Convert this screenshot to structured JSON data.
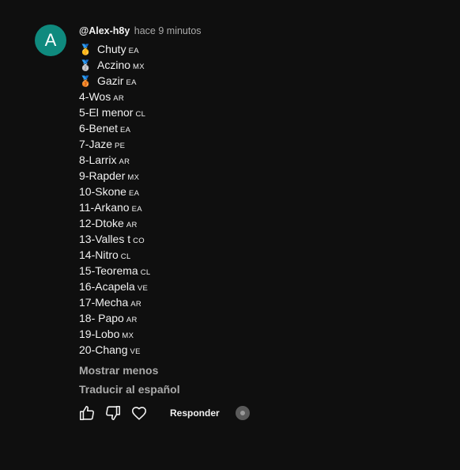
{
  "comment": {
    "avatar_letter": "A",
    "author": "@Alex-h8y",
    "time": "hace 9 minutos",
    "medals": [
      {
        "icon": "gold-medal",
        "glyph": "🥇",
        "name": "Chuty",
        "cc": "EA"
      },
      {
        "icon": "silver-medal",
        "glyph": "🥈",
        "name": "Aczino",
        "cc": "MX"
      },
      {
        "icon": "bronze-medal",
        "glyph": "🥉",
        "name": "Gazir",
        "cc": "EA"
      }
    ],
    "ranking": [
      {
        "name": "4-Wos",
        "cc": "AR"
      },
      {
        "name": "5-El menor",
        "cc": "CL"
      },
      {
        "name": "6-Benet",
        "cc": "EA"
      },
      {
        "name": "7-Jaze",
        "cc": "PE"
      },
      {
        "name": "8-Larrix",
        "cc": "AR"
      },
      {
        "name": "9-Rapder",
        "cc": "MX"
      },
      {
        "name": "10-Skone",
        "cc": "EA"
      },
      {
        "name": "11-Arkano",
        "cc": "EA"
      },
      {
        "name": "12-Dtoke",
        "cc": "AR"
      },
      {
        "name": "13-Valles t",
        "cc": "CO"
      },
      {
        "name": "14-Nitro",
        "cc": "CL"
      },
      {
        "name": "15-Teorema",
        "cc": "CL"
      },
      {
        "name": "16-Acapela",
        "cc": "VE"
      },
      {
        "name": "17-Mecha",
        "cc": "AR"
      },
      {
        "name": "18- Papo",
        "cc": "AR"
      },
      {
        "name": "19-Lobo",
        "cc": "MX"
      },
      {
        "name": "20-Chang",
        "cc": "VE"
      }
    ],
    "show_less_label": "Mostrar menos",
    "translate_label": "Traducir al español"
  },
  "actions": {
    "like_icon": "thumbs-up-icon",
    "dislike_icon": "thumbs-down-icon",
    "heart_icon": "heart-icon",
    "reply_label": "Responder",
    "avatar_icon": "creator-avatar-icon"
  },
  "colors": {
    "background": "#0f0f0f",
    "avatar": "#0f8a7e",
    "text": "#f1f1f1",
    "muted": "#aaaaaa"
  }
}
